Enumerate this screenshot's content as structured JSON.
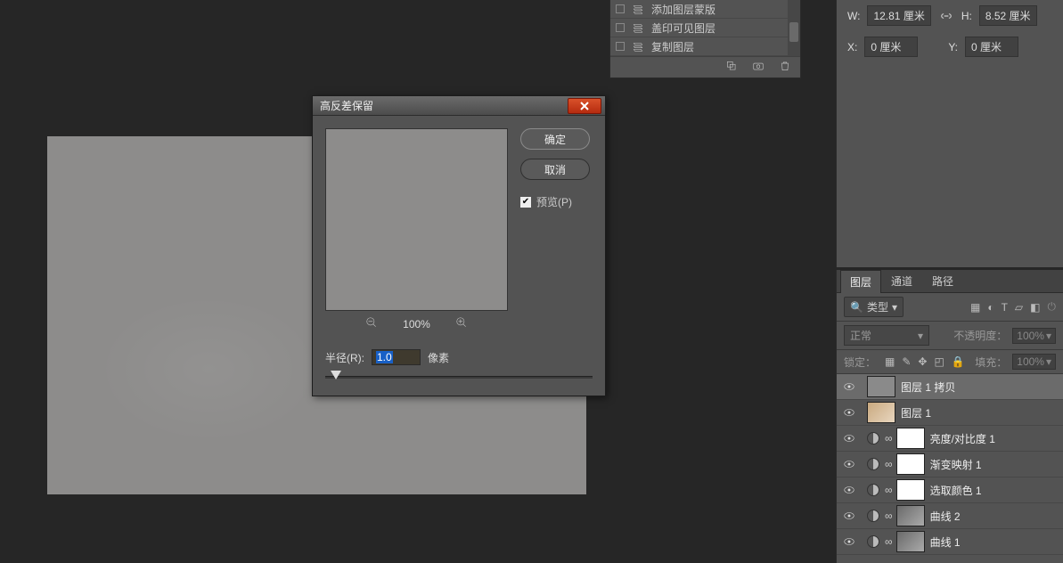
{
  "props": {
    "w_label": "W:",
    "w_value": "12.81 厘米",
    "h_label": "H:",
    "h_value": "8.52 厘米",
    "x_label": "X:",
    "x_value": "0 厘米",
    "y_label": "Y:",
    "y_value": "0 厘米"
  },
  "layercomps": {
    "items": [
      {
        "label": "添加图层蒙版"
      },
      {
        "label": "盖印可见图层"
      },
      {
        "label": "复制图层"
      }
    ]
  },
  "dialog": {
    "title": "高反差保留",
    "ok": "确定",
    "cancel": "取消",
    "preview_label": "预览(P)",
    "zoom": "100%",
    "radius_label": "半径(R):",
    "radius_value": "1.0",
    "radius_unit": "像素"
  },
  "tabs": {
    "layers": "图层",
    "channels": "通道",
    "paths": "路径"
  },
  "filter": {
    "type": "类型"
  },
  "blend": {
    "mode": "正常",
    "opacity_label": "不透明度：",
    "opacity_value": "100%"
  },
  "lock": {
    "label": "锁定：",
    "fill_label": "填充：",
    "fill_value": "100%"
  },
  "layers": [
    {
      "name": "图层 1 拷贝",
      "kind": "grey",
      "selected": true
    },
    {
      "name": "图层 1",
      "kind": "img1"
    },
    {
      "name": "亮度/对比度 1",
      "kind": "adj"
    },
    {
      "name": "渐变映射 1",
      "kind": "adj"
    },
    {
      "name": "选取颜色 1",
      "kind": "adj"
    },
    {
      "name": "曲线 2",
      "kind": "adjimg"
    },
    {
      "name": "曲线 1",
      "kind": "adjimg"
    }
  ]
}
